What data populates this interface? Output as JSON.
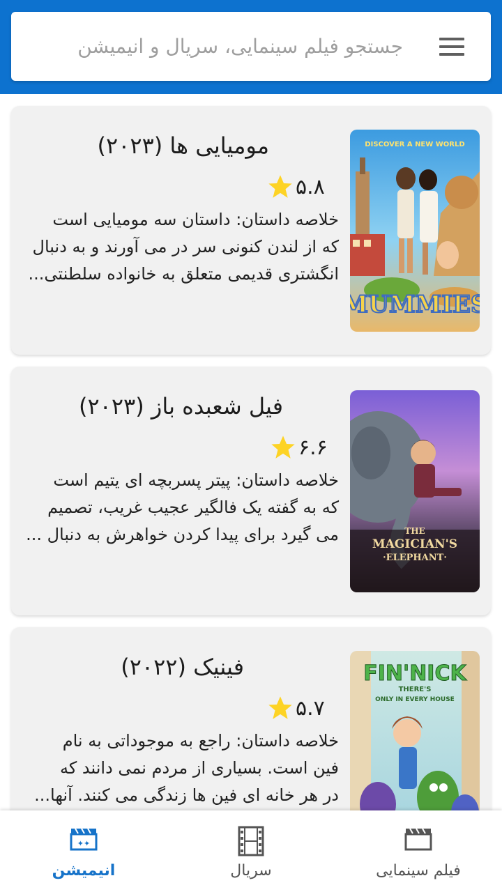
{
  "search": {
    "placeholder": "جستجو فیلم سینمایی، سریال و انیمیشن"
  },
  "colors": {
    "topbar": "#0d72cf",
    "active_tab": "#1673c9",
    "inactive_tab": "#555555",
    "star": "#fdd325"
  },
  "cards": [
    {
      "title": "مومیایی ها (۲۰۲۳)",
      "rating": "۵.۸",
      "summary_lines": [
        "خلاصه داستان: داستان سه مومیایی است",
        "که از لندن کنونی سر در می آورند و به دنبال",
        "انگشتری قدیمی متعلق به خانواده سلطنتی..."
      ],
      "poster_text_top": "DISCOVER A NEW WORLD",
      "poster_text": "MUMMIES"
    },
    {
      "title": "فیل شعبده باز (۲۰۲۳)",
      "rating": "۶.۶",
      "summary_lines": [
        "خلاصه داستان: پیتر پسربچه ای یتیم است",
        "که به گفته یک فالگیر عجیب غریب، تصمیم",
        "می گیرد برای پیدا کردن خواهرش به دنبال ..."
      ],
      "poster_text_top": "THE",
      "poster_text": "MAGICIAN'S",
      "poster_text_bottom": "·ELEPHANT·"
    },
    {
      "title": "فینیک (۲۰۲۲)",
      "rating": "۵.۷",
      "summary_lines": [
        "خلاصه داستان: راجع به موجوداتی به نام",
        "فین است. بسیاری از مردم نمی دانند که",
        "در هر خانه ای فین ها زندگی می کنند. آنها..."
      ],
      "poster_text": "FIN'NICK",
      "poster_text_top": "THERE'S",
      "poster_text_bottom": "ONLY IN EVERY HOUSE"
    }
  ],
  "nav": {
    "items": [
      {
        "label": "انیمیشن",
        "icon": "animation-clapper-icon",
        "active": true
      },
      {
        "label": "سریال",
        "icon": "film-strip-icon",
        "active": false
      },
      {
        "label": "فیلم سینمایی",
        "icon": "clapperboard-icon",
        "active": false
      }
    ]
  }
}
